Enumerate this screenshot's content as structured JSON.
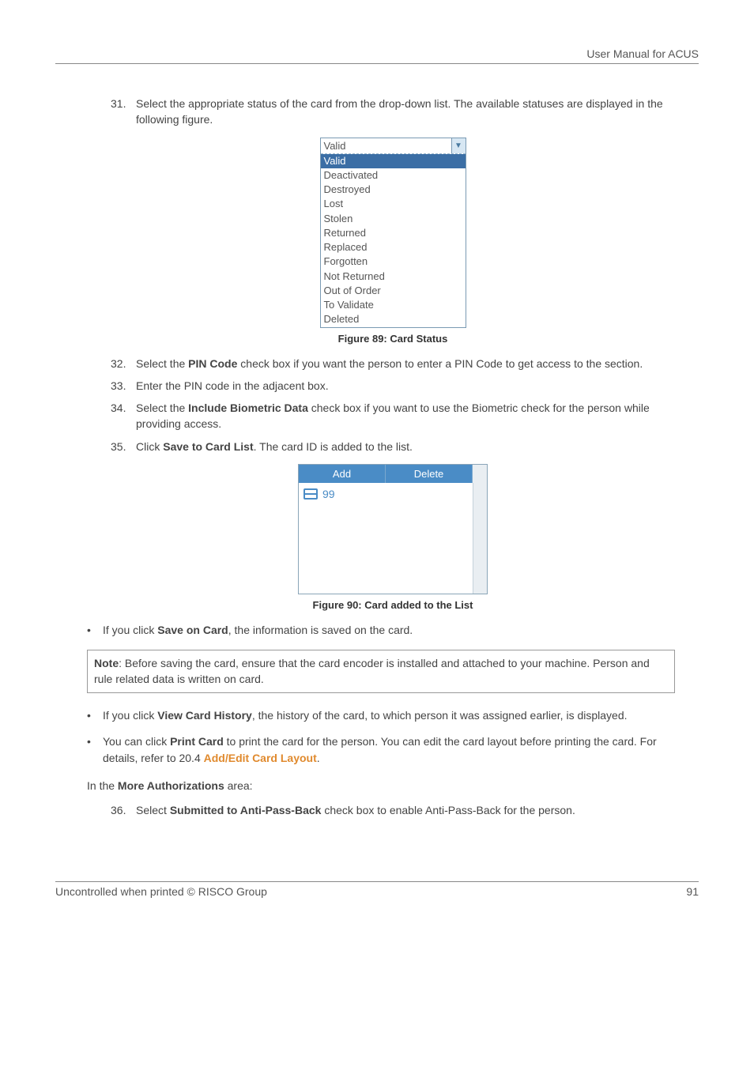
{
  "header": {
    "title": "User Manual for ACUS"
  },
  "steps": {
    "s31": {
      "num": "31.",
      "text_a": "Select the appropriate status of the card from the drop-down list. The available statuses are displayed in the following figure."
    },
    "s32": {
      "num": "32.",
      "text_a": "Select the ",
      "bold_a": "PIN Code",
      "text_b": " check box if you want the person to enter a PIN Code to get access to the section."
    },
    "s33": {
      "num": "33.",
      "text_a": "Enter the PIN code in the adjacent box."
    },
    "s34": {
      "num": "34.",
      "text_a": "Select the ",
      "bold_a": "Include Biometric Data",
      "text_b": " check box if you want to use the Biometric check for the person while providing access."
    },
    "s35": {
      "num": "35.",
      "text_a": "Click ",
      "bold_a": "Save to Card List",
      "text_b": ". The card ID is added to the list."
    },
    "s36": {
      "num": "36.",
      "text_a": "Select ",
      "bold_a": "Submitted to Anti-Pass-Back",
      "text_b": " check box to enable Anti-Pass-Back for the person."
    }
  },
  "dropdown": {
    "selected_display": "Valid",
    "options": {
      "o0": "Valid",
      "o1": "Deactivated",
      "o2": "Destroyed",
      "o3": "Lost",
      "o4": "Stolen",
      "o5": "Returned",
      "o6": "Replaced",
      "o7": "Forgotten",
      "o8": "Not Returned",
      "o9": "Out of Order",
      "o10": "To Validate",
      "o11": "Deleted"
    }
  },
  "figures": {
    "f89": "Figure 89: Card Status",
    "f90": "Figure 90: Card added to the List"
  },
  "cardlist": {
    "add": "Add",
    "delete": "Delete",
    "item": "99"
  },
  "bullets": {
    "b1": {
      "text_a": "If you click ",
      "bold_a": "Save on Card",
      "text_b": ", the information is saved on the card."
    },
    "b2": {
      "text_a": "If you click ",
      "bold_a": "View Card History",
      "text_b": ", the history of the card, to which person it was assigned earlier, is displayed."
    },
    "b3": {
      "text_a": "You can click ",
      "bold_a": "Print Card",
      "text_b": " to print the card for the person. You can edit the card layout before printing the card. For details, refer to 20.4 ",
      "link": "Add/Edit Card Layout",
      "text_c": "."
    }
  },
  "note": {
    "label": "Note",
    "text_a": ": Before saving the card, ensure that the card encoder is installed and attached to your machine. Person and rule related data is written on card."
  },
  "more_auth": {
    "text_a": "In the ",
    "bold_a": "More Authorizations",
    "text_b": " area:"
  },
  "footer": {
    "left": "Uncontrolled when printed © RISCO Group",
    "right": "91"
  }
}
